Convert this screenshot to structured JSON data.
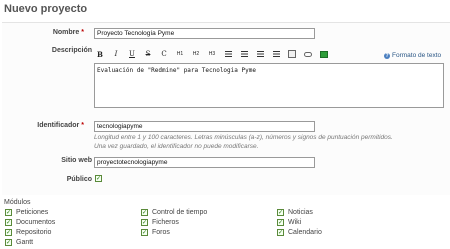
{
  "page": {
    "title": "Nuevo proyecto"
  },
  "form": {
    "name": {
      "label": "Nombre",
      "required": "*",
      "value": "Proyecto Tecnología Pyme"
    },
    "description": {
      "label": "Descripción",
      "help_link": "Formato de texto",
      "content": "Evaluación de \"Redmine\" para Tecnologia Pyme",
      "toolbar": [
        "B",
        "I",
        "U",
        "S",
        "C",
        "H1",
        "H2",
        "H3"
      ]
    },
    "identifier": {
      "label": "Identificador",
      "required": "*",
      "value": "tecnologiapyme",
      "note_line1": "Longitud entre 1 y 100 caracteres. Letras minúsculas (a-z), números y signos de puntuación permitidos.",
      "note_line2": "Una vez guardado, el identificador no puede modificarse."
    },
    "website": {
      "label": "Sitio web",
      "value": "proyectotecnologiapyme"
    },
    "public": {
      "label": "Público",
      "checked": true
    }
  },
  "modules": {
    "title": "Módulos",
    "items": [
      {
        "label": "Peticiones",
        "checked": true
      },
      {
        "label": "Documentos",
        "checked": true
      },
      {
        "label": "Repositorio",
        "checked": true
      },
      {
        "label": "Gantt",
        "checked": true
      },
      {
        "label": "Control de tiempo",
        "checked": true
      },
      {
        "label": "Ficheros",
        "checked": true
      },
      {
        "label": "Foros",
        "checked": true
      },
      {
        "label": "Noticias",
        "checked": true
      },
      {
        "label": "Wiki",
        "checked": true
      },
      {
        "label": "Calendario",
        "checked": true
      }
    ]
  }
}
